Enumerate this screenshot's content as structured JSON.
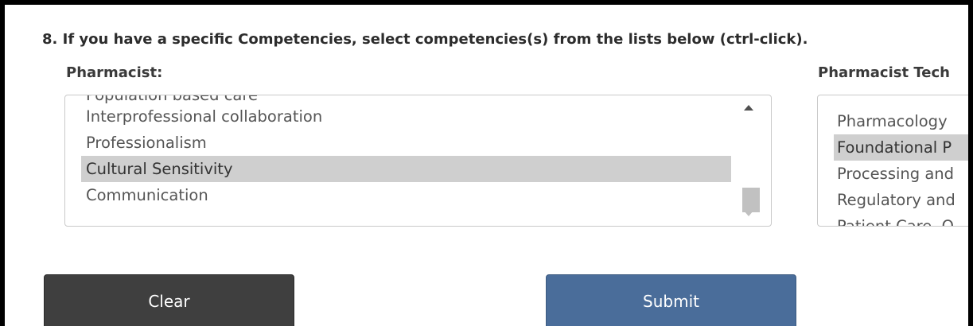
{
  "question": {
    "text": "8. If you have a specific Competencies, select competencies(s) from the lists below (ctrl-click)."
  },
  "pharmacist": {
    "label": "Pharmacist:",
    "options": [
      {
        "text": "Population based care",
        "selected": false
      },
      {
        "text": "Interprofessional collaboration",
        "selected": false
      },
      {
        "text": "Professionalism",
        "selected": false
      },
      {
        "text": "Cultural Sensitivity",
        "selected": true
      },
      {
        "text": "Communication",
        "selected": false
      }
    ]
  },
  "technician": {
    "label": "Pharmacist Tech",
    "options": [
      {
        "text": "Pharmacology",
        "selected": false
      },
      {
        "text": "Foundational P",
        "selected": true
      },
      {
        "text": "Processing and",
        "selected": false
      },
      {
        "text": "Regulatory and",
        "selected": false
      },
      {
        "text": "Patient Care, O",
        "selected": false
      }
    ]
  },
  "buttons": {
    "clear": "Clear",
    "submit": "Submit"
  },
  "colors": {
    "selected_bg": "#cfcfcf",
    "clear_button": "#3f3f3f",
    "submit_button": "#4a6d9a"
  }
}
